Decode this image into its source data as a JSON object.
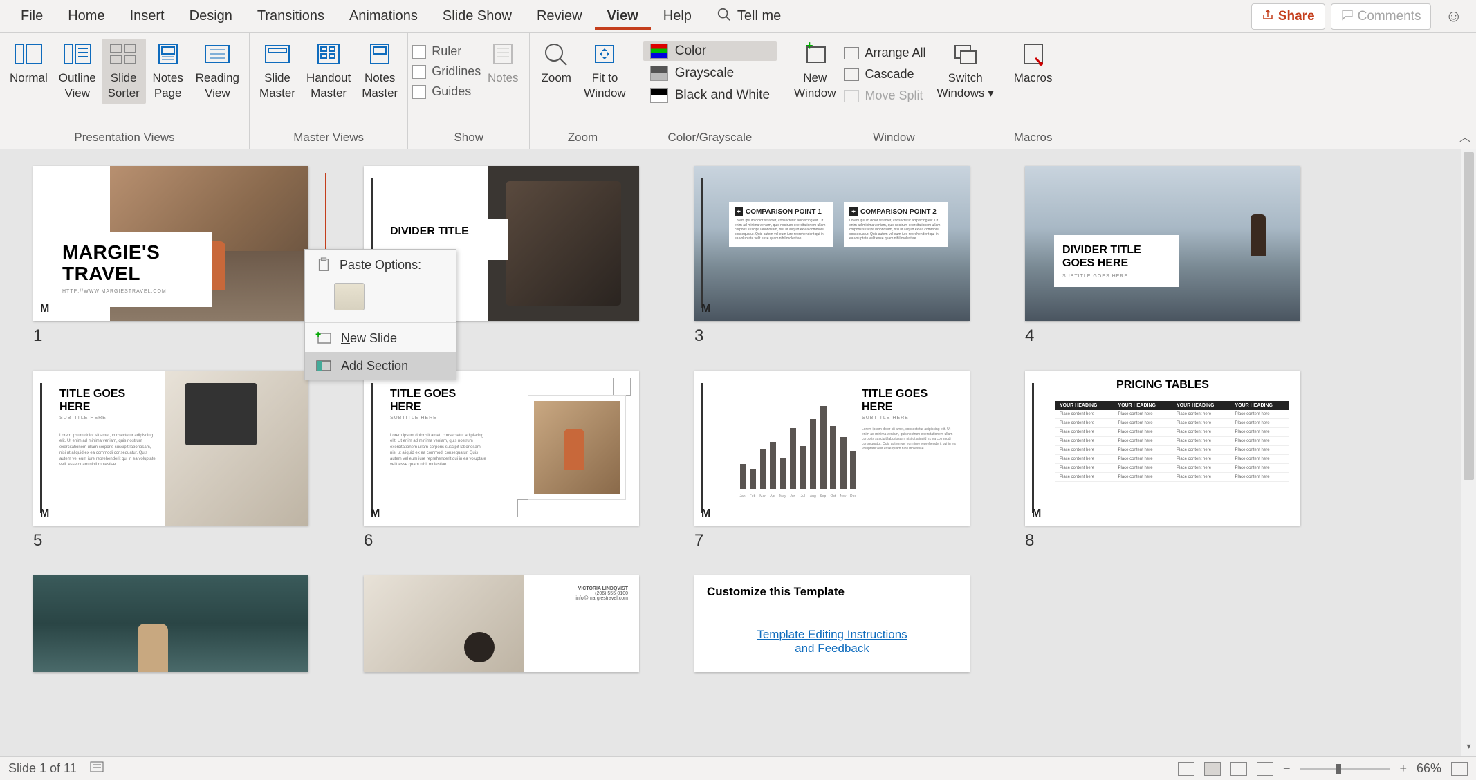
{
  "menubar": {
    "items": [
      "File",
      "Home",
      "Insert",
      "Design",
      "Transitions",
      "Animations",
      "Slide Show",
      "Review",
      "View",
      "Help"
    ],
    "active_index": 8,
    "tell_me": "Tell me",
    "share": "Share",
    "comments": "Comments"
  },
  "ribbon": {
    "groups": {
      "presentation_views": {
        "label": "Presentation Views",
        "buttons": [
          {
            "label": "Normal"
          },
          {
            "label": "Outline\nView"
          },
          {
            "label": "Slide\nSorter",
            "active": true
          },
          {
            "label": "Notes\nPage"
          },
          {
            "label": "Reading\nView"
          }
        ]
      },
      "master_views": {
        "label": "Master Views",
        "buttons": [
          {
            "label": "Slide\nMaster"
          },
          {
            "label": "Handout\nMaster"
          },
          {
            "label": "Notes\nMaster"
          }
        ]
      },
      "show": {
        "label": "Show",
        "checks": [
          "Ruler",
          "Gridlines",
          "Guides"
        ],
        "notes": "Notes"
      },
      "zoom": {
        "label": "Zoom",
        "buttons": [
          "Zoom",
          "Fit to\nWindow"
        ]
      },
      "color_grayscale": {
        "label": "Color/Grayscale",
        "options": [
          "Color",
          "Grayscale",
          "Black and White"
        ],
        "active_index": 0
      },
      "window": {
        "label": "Window",
        "new_window": "New\nWindow",
        "rows": [
          {
            "label": "Arrange All",
            "enabled": true
          },
          {
            "label": "Cascade",
            "enabled": true
          },
          {
            "label": "Move Split",
            "enabled": false
          }
        ],
        "switch": "Switch\nWindows"
      },
      "macros": {
        "label": "Macros",
        "button": "Macros"
      }
    }
  },
  "slides": [
    {
      "num": "1",
      "type": "hero",
      "title": "MARGIE'S\nTRAVEL",
      "url": "HTTP://WWW.MARGIESTRAVEL.COM"
    },
    {
      "num": "",
      "type": "suitcase",
      "title": "DIVIDER TITLE"
    },
    {
      "num": "3",
      "type": "comparison",
      "h1": "COMPARISON POINT 1",
      "h2": "COMPARISON POINT 2"
    },
    {
      "num": "4",
      "type": "mountain",
      "title": "DIVIDER TITLE\nGOES HERE",
      "sub": "SUBTITLE GOES HERE"
    },
    {
      "num": "5",
      "type": "desk",
      "title": "TITLE GOES\nHERE",
      "sub": "SUBTITLE HERE"
    },
    {
      "num": "6",
      "type": "photo",
      "title": "TITLE GOES\nHERE",
      "sub": "SUBTITLE HERE"
    },
    {
      "num": "7",
      "type": "chart",
      "title": "TITLE GOES\nHERE",
      "sub": "SUBTITLE HERE"
    },
    {
      "num": "8",
      "type": "pricing",
      "title": "PRICING TABLES"
    },
    {
      "num": "",
      "type": "lake"
    },
    {
      "num": "",
      "type": "flatlay",
      "contact_name": "VICTORIA LINDQVIST",
      "contact_phone": "(206) 555-0100",
      "contact_email": "info@margiestravel.com"
    },
    {
      "num": "",
      "type": "customize",
      "title": "Customize this Template",
      "link": "Template Editing Instructions\nand Feedback"
    }
  ],
  "chart_data": {
    "type": "bar",
    "categories": [
      "Jan",
      "Feb",
      "Mar",
      "Apr",
      "May",
      "Jun",
      "Jul",
      "Aug",
      "Sep",
      "Oct",
      "Nov",
      "Dec"
    ],
    "values": [
      28,
      22,
      45,
      52,
      35,
      68,
      48,
      78,
      92,
      70,
      58,
      42
    ],
    "ylim": [
      0,
      100
    ]
  },
  "pricing_table": {
    "headers": [
      "YOUR HEADING",
      "YOUR HEADING",
      "YOUR HEADING",
      "YOUR HEADING"
    ],
    "cell": "Place content here",
    "rows": 8
  },
  "context_menu": {
    "paste_header": "Paste Options:",
    "new_slide": "New Slide",
    "add_section": "Add Section"
  },
  "lorem": "Lorem ipsum dolor sit amet, consectetur adipiscing elit. Ut enim ad minima veniam, quis nostrum exercitationem ullam corporis suscipit laboriosam, nisi ut aliquid ex ea commodi consequatur. Quis autem vel eum iure reprehenderit qui in ea voluptate velit esse quam nihil molestiae.",
  "status": {
    "slide_count": "Slide 1 of 11",
    "zoom": "66%"
  }
}
